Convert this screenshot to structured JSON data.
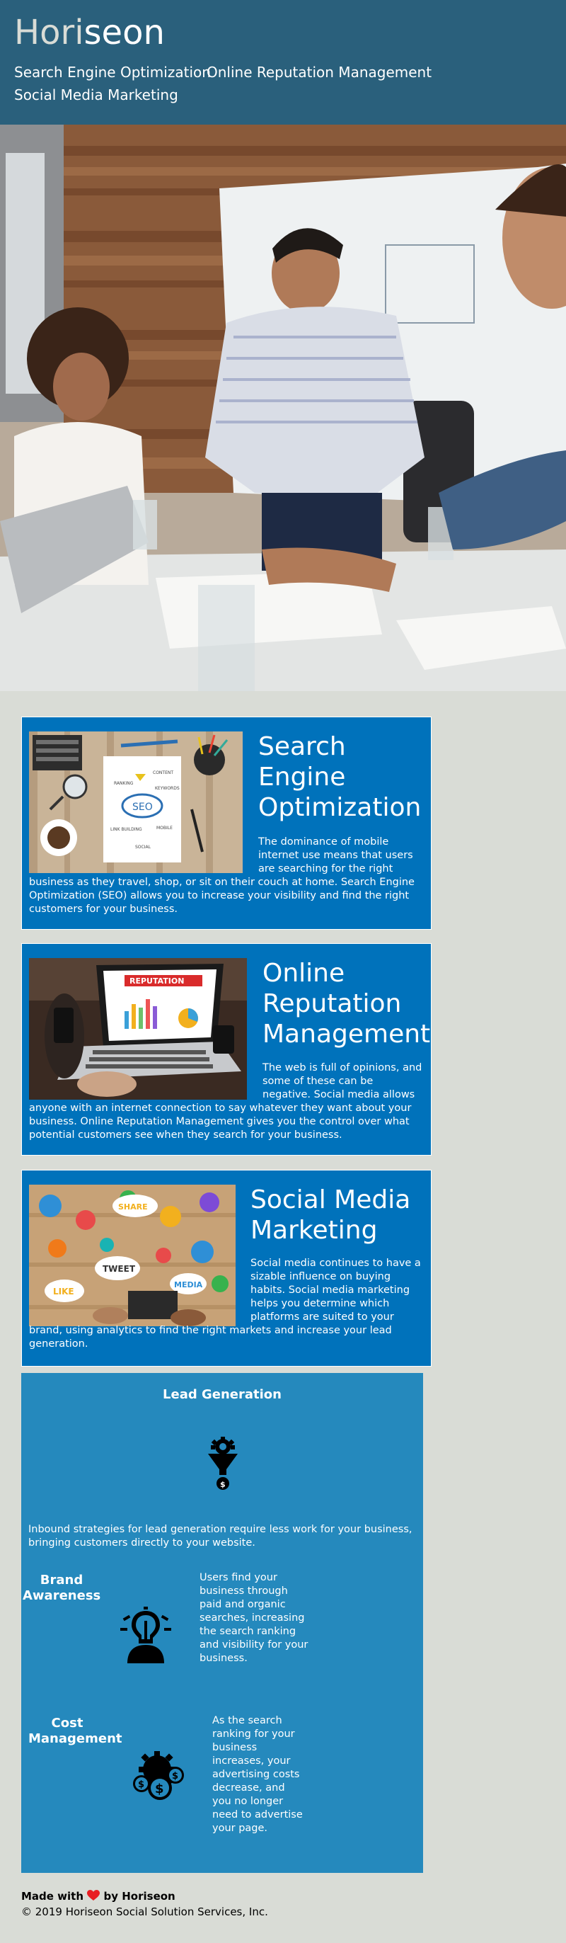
{
  "header": {
    "logo_text": "Hori",
    "logo_highlight": "seon",
    "nav": [
      {
        "label": "Search Engine Optimization"
      },
      {
        "label": "Online Reputation Management"
      },
      {
        "label": "Social Media Marketing"
      }
    ]
  },
  "colors": {
    "header_bg": "#2a607c",
    "page_bg": "#d9dcd6",
    "card_bg": "#0072bb",
    "benefits_bg": "#2589bd",
    "heart": "#e81e23"
  },
  "content": [
    {
      "title": "Search Engine Optimization",
      "image_icon": "seo-notebook-image",
      "text": "The dominance of mobile internet use means that users are searching for the right business as they travel, shop, or sit on their couch at home. Search Engine Optimization (SEO) allows you to increase your visibility and find the right customers for your business."
    },
    {
      "title": "Online Reputation Management",
      "image_icon": "reputation-laptop-image",
      "text": "The web is full of opinions, and some of these can be negative. Social media allows anyone with an internet connection to say whatever they want about your business. Online Reputation Management gives you the control over what potential customers see when they search for your business."
    },
    {
      "title": "Social Media Marketing",
      "image_icon": "social-media-image",
      "text": "Social media continues to have a sizable influence on buying habits. Social media marketing helps you determine which platforms are suited to your brand, using analytics to find the right markets and increase your lead generation."
    }
  ],
  "benefits": {
    "lead": {
      "title": "Lead Generation",
      "icon": "funnel-gear-icon",
      "text": "Inbound strategies for lead generation require less work for your business, bringing customers directly to your website."
    },
    "brand": {
      "title": "Brand Awareness",
      "icon": "lightbulb-head-icon",
      "text": "Users find your business through paid and organic searches, increasing the search ranking and visibility for your business."
    },
    "cost": {
      "title": "Cost Management",
      "icon": "gear-dollar-icon",
      "text": "As the search ranking for your business increases, your advertising costs decrease, and you no longer need to advertise your page."
    }
  },
  "footer": {
    "made_with": "Made with",
    "by": "by Horiseon",
    "heart_icon": "heart-icon",
    "copyright": "© 2019 Horiseon Social Solution Services, Inc."
  }
}
